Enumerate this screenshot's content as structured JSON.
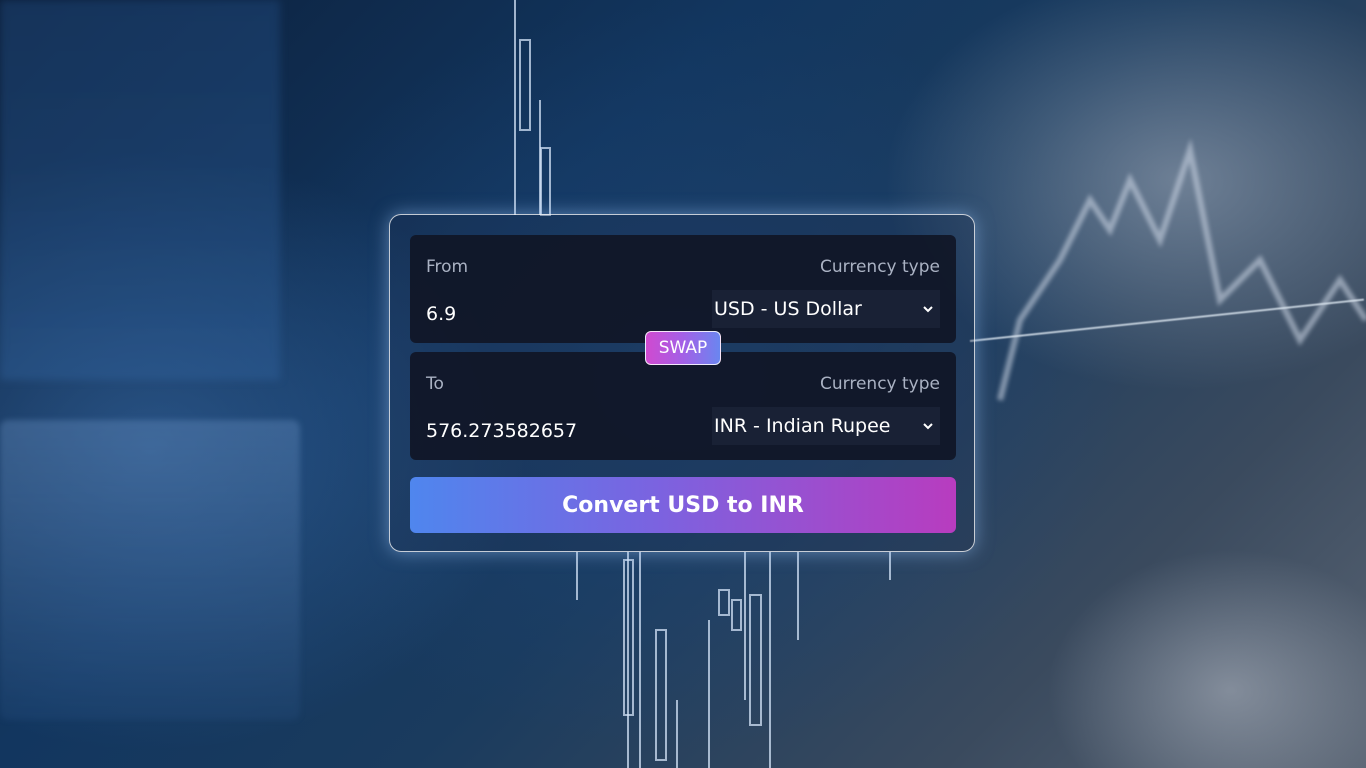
{
  "converter": {
    "from": {
      "label": "From",
      "currency_label": "Currency type",
      "amount": "6.9",
      "currency": "USD - US Dollar"
    },
    "swap_label": "SWAP",
    "to": {
      "label": "To",
      "currency_label": "Currency type",
      "amount": "576.273582657",
      "currency": "INR - Indian Rupee"
    },
    "convert_label": "Convert USD to INR"
  },
  "icons": {
    "chevron": "chevron-down-icon"
  },
  "colors": {
    "card_box": "#101626",
    "swap_gradient_start": "#d04ad0",
    "swap_gradient_end": "#6a86f0",
    "convert_gradient_start": "#4f86ee",
    "convert_gradient_end": "#b83cbf"
  }
}
